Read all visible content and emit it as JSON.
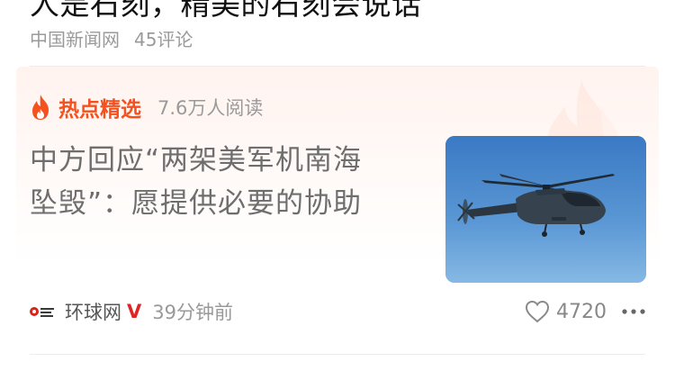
{
  "previous_article": {
    "title": "人是石刻，精美的石刻会说话",
    "source": "中国新闻网",
    "comments": "45评论"
  },
  "hot_pick": {
    "label": "热点精选",
    "reads": "7.6万人阅读",
    "title_line1": "中方回应“两架美军机南海",
    "title_line2": "坠毁”：愿提供必要的协助",
    "thumbnail": "helicopter-image",
    "source": "环球网",
    "source_logo_text": "环球网",
    "verified_mark": "V",
    "time": "39分钟前",
    "likes": "4720"
  },
  "colors": {
    "accent": "#f4511e",
    "verified": "#e02424",
    "title_gray": "#6e6e6e"
  }
}
